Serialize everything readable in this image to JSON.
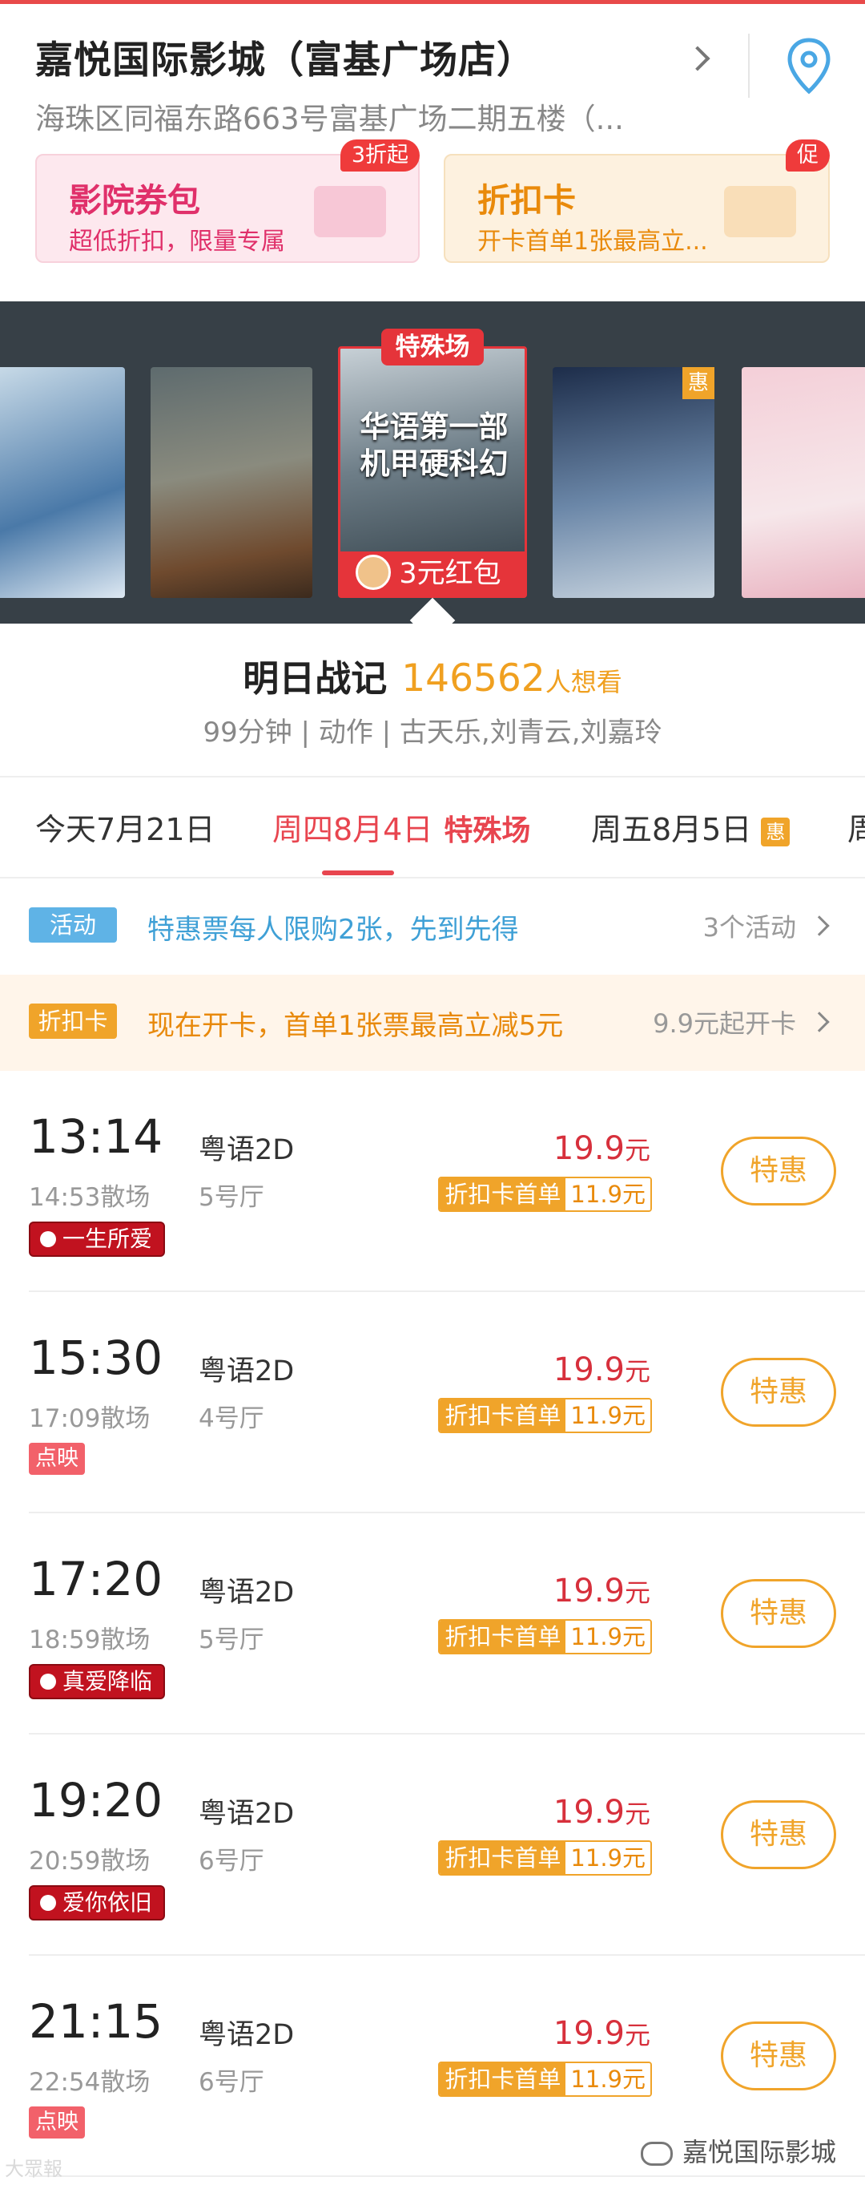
{
  "cinema": {
    "name": "嘉悦国际影城（富基广场店）",
    "address": "海珠区同福东路663号富基广场二期五楼（..."
  },
  "cards": {
    "coupon": {
      "title": "影院券包",
      "sub": "超低折扣，限量专属",
      "badge": "3折起"
    },
    "discount": {
      "title": "折扣卡",
      "sub": "开卡首单1张最高立...",
      "badge": "促"
    }
  },
  "posters": {
    "special_tag": "特殊场",
    "special_text": "华语第一部 机甲硬科幻",
    "special_red": "3元红包",
    "hui_tag": "惠"
  },
  "movie": {
    "name": "明日战记",
    "want_count": "146562",
    "want_suffix": "人想看",
    "meta": "99分钟 | 动作 | 古天乐,刘青云,刘嘉玲"
  },
  "dates": {
    "tab1": "今天7月21日",
    "tab2": "周四8月4日",
    "tab2_tag": "特殊场",
    "tab3": "周五8月5日",
    "tab3_tag": "惠",
    "tab4": "周"
  },
  "activity": {
    "badge": "活动",
    "text": "特惠票每人限购2张，先到先得",
    "right": "3个活动"
  },
  "discount_row": {
    "badge": "折扣卡",
    "text": "现在开卡，首单1张票最高立减5元",
    "right": "9.9元起开卡"
  },
  "showtimes": [
    {
      "time": "13:14",
      "end": "14:53散场",
      "lang": "粤语2D",
      "hall": "5号厅",
      "price": "19.9",
      "unit": "元",
      "card_label": "折扣卡首单",
      "card_price": "11.9元",
      "button": "特惠",
      "tag": "一生所爱",
      "tag_type": "love"
    },
    {
      "time": "15:30",
      "end": "17:09散场",
      "lang": "粤语2D",
      "hall": "4号厅",
      "price": "19.9",
      "unit": "元",
      "card_label": "折扣卡首单",
      "card_price": "11.9元",
      "button": "特惠",
      "tag": "点映",
      "tag_type": "dy"
    },
    {
      "time": "17:20",
      "end": "18:59散场",
      "lang": "粤语2D",
      "hall": "5号厅",
      "price": "19.9",
      "unit": "元",
      "card_label": "折扣卡首单",
      "card_price": "11.9元",
      "button": "特惠",
      "tag": "真爱降临",
      "tag_type": "love"
    },
    {
      "time": "19:20",
      "end": "20:59散场",
      "lang": "粤语2D",
      "hall": "6号厅",
      "price": "19.9",
      "unit": "元",
      "card_label": "折扣卡首单",
      "card_price": "11.9元",
      "button": "特惠",
      "tag": "爱你依旧",
      "tag_type": "love"
    },
    {
      "time": "21:15",
      "end": "22:54散场",
      "lang": "粤语2D",
      "hall": "6号厅",
      "price": "19.9",
      "unit": "元",
      "card_label": "折扣卡首单",
      "card_price": "11.9元",
      "button": "特惠",
      "tag": "点映",
      "tag_type": "dy"
    }
  ],
  "watermark": {
    "left": "大眾報",
    "right": "嘉悦国际影城"
  }
}
